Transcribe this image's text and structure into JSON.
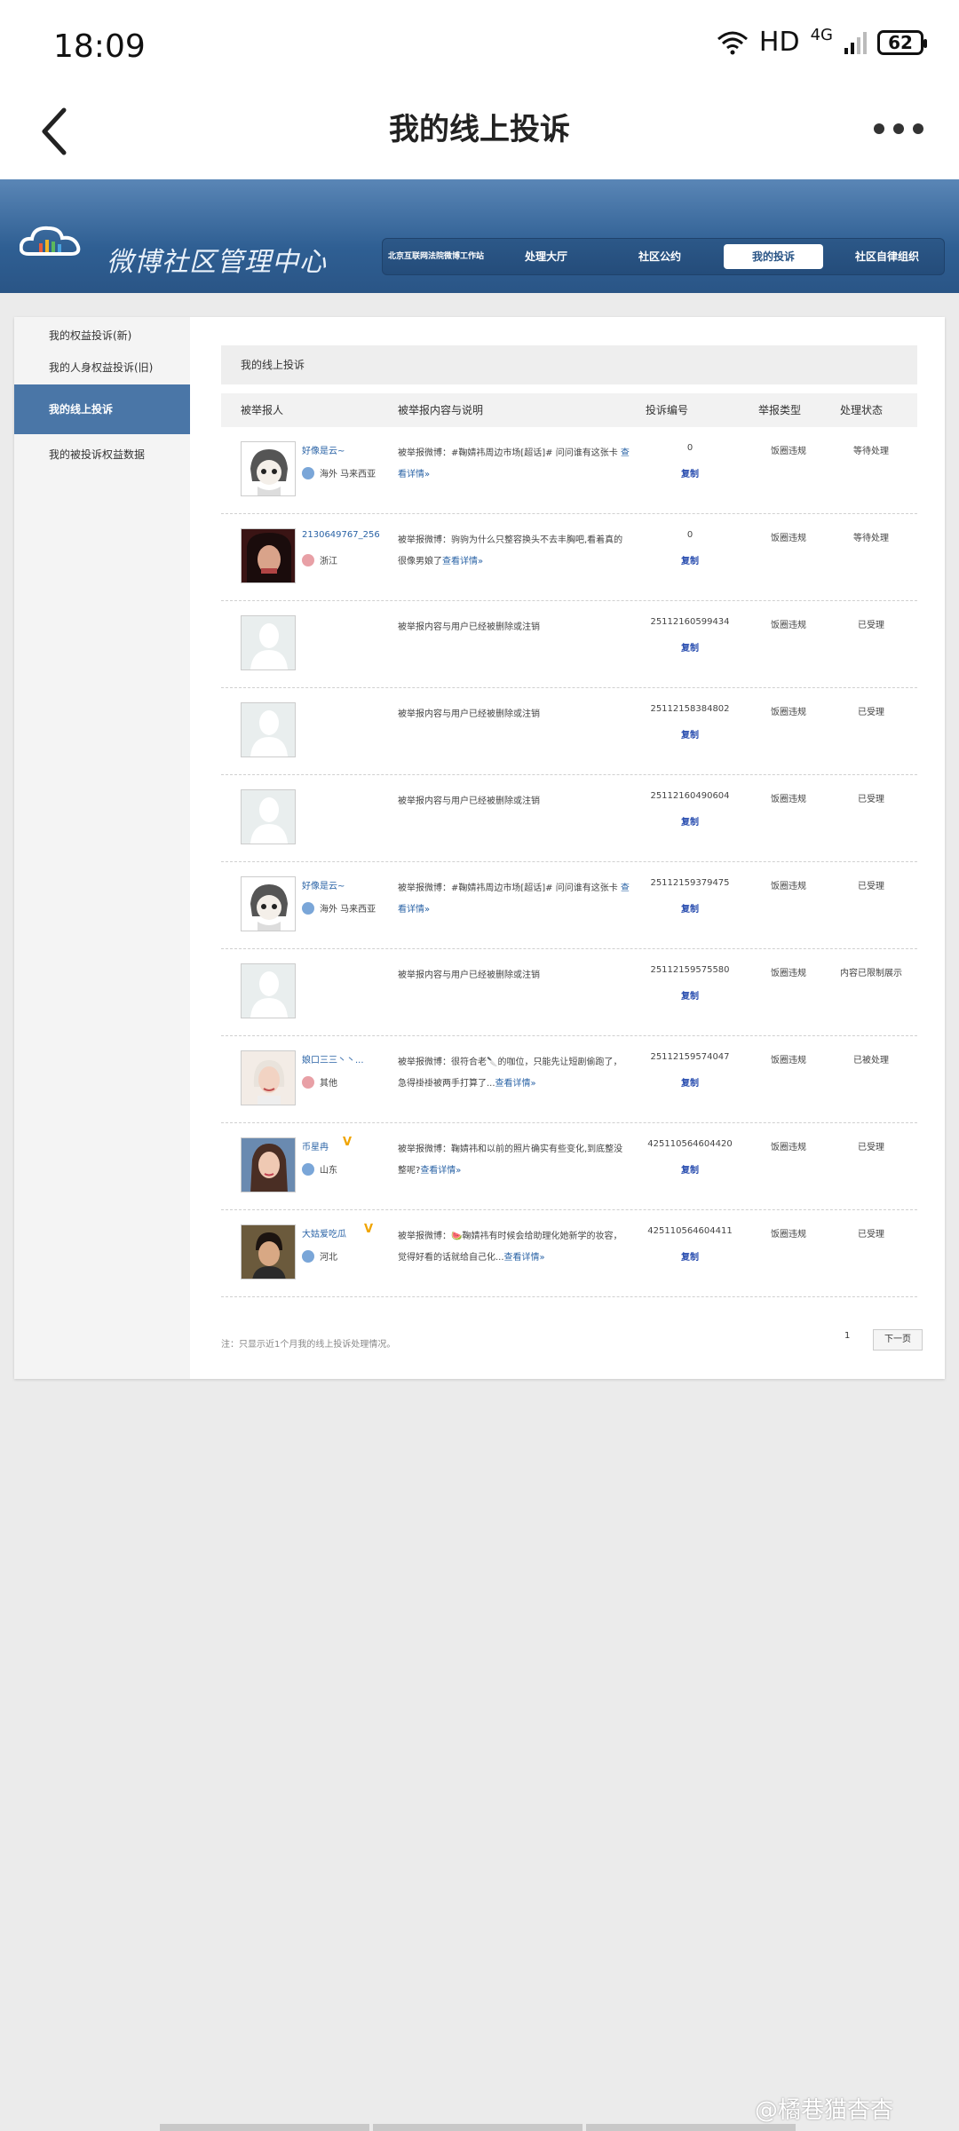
{
  "status_bar": {
    "time": "18:09",
    "network": "HD",
    "cell": "4G",
    "battery": "62"
  },
  "app_bar": {
    "title": "我的线上投诉"
  },
  "banner": {
    "brand": "微博社区管理中心",
    "nav": [
      {
        "label": "北京互联网法院微博工作站"
      },
      {
        "label": "处理大厅"
      },
      {
        "label": "社区公约"
      },
      {
        "label": "我的投诉"
      },
      {
        "label": "社区自律组织"
      }
    ]
  },
  "sidebar": {
    "items": [
      {
        "label": "我的权益投诉(新)"
      },
      {
        "label": "我的人身权益投诉(旧)"
      },
      {
        "label": "我的线上投诉"
      },
      {
        "label": "我的被投诉权益数据"
      }
    ]
  },
  "main": {
    "title": "我的线上投诉",
    "columns": {
      "reporter": "被举报人",
      "content": "被举报内容与说明",
      "id": "投诉编号",
      "type": "举报类型",
      "status": "处理状态"
    },
    "copy_label": "复制",
    "rows": [
      {
        "name": "好像是云~",
        "location": "海外 马来西亚",
        "gender": "m",
        "verified": false,
        "avatar": "anime",
        "desc": "被举报微博：#鞠婧祎周边市场[超话]# 问问谁有这张卡 ",
        "link": "查看详情»",
        "id": "0",
        "type": "饭圈违规",
        "status": "等待处理"
      },
      {
        "name": "2130649767_256",
        "location": "浙江",
        "gender": "f",
        "verified": false,
        "avatar": "dark",
        "desc": "被举报微博：驹驹为什么只整容换头不去丰胸吧,看着真的很像男娘了",
        "link": "查看详情»",
        "id": "0",
        "type": "饭圈违规",
        "status": "等待处理"
      },
      {
        "name": "",
        "location": "",
        "gender": "",
        "verified": false,
        "avatar": "blank",
        "desc": "被举报内容与用户已经被删除或注销",
        "link": "",
        "id": "25112160599434",
        "type": "饭圈违规",
        "status": "已受理"
      },
      {
        "name": "",
        "location": "",
        "gender": "",
        "verified": false,
        "avatar": "blank",
        "desc": "被举报内容与用户已经被删除或注销",
        "link": "",
        "id": "25112158384802",
        "type": "饭圈违规",
        "status": "已受理"
      },
      {
        "name": "",
        "location": "",
        "gender": "",
        "verified": false,
        "avatar": "blank",
        "desc": "被举报内容与用户已经被删除或注销",
        "link": "",
        "id": "25112160490604",
        "type": "饭圈违规",
        "status": "已受理"
      },
      {
        "name": "好像是云~",
        "location": "海外 马来西亚",
        "gender": "m",
        "verified": false,
        "avatar": "anime",
        "desc": "被举报微博：#鞠婧祎周边市场[超话]# 问问谁有这张卡 ",
        "link": "查看详情»",
        "id": "25112159379475",
        "type": "饭圈违规",
        "status": "已受理"
      },
      {
        "name": "",
        "location": "",
        "gender": "",
        "verified": false,
        "avatar": "blank",
        "desc": "被举报内容与用户已经被删除或注销",
        "link": "",
        "id": "25112159575580",
        "type": "饭圈违规",
        "status": "内容已限制展示"
      },
      {
        "name": "娘口三三丶丶...",
        "location": "其他",
        "gender": "f",
        "verified": false,
        "avatar": "girl",
        "desc": "被举报微博：很符合老🔪的咖位，只能先让短剧偷跑了，急得褂褂被两手打算了...",
        "link": "查看详情»",
        "id": "25112159574047",
        "type": "饭圈违规",
        "status": "已被处理"
      },
      {
        "name": "币星冉",
        "location": "山东",
        "gender": "m",
        "verified": true,
        "avatar": "woman",
        "desc": "被举报微博：鞠婧祎和以前的照片确实有些变化,到底整没整呢?",
        "link": "查看详情»",
        "id": "425110564604420",
        "type": "饭圈违规",
        "status": "已受理"
      },
      {
        "name": "大姑爱吃瓜",
        "location": "河北",
        "gender": "m",
        "verified": true,
        "avatar": "man",
        "desc": "被举报微博：🍉鞠婧祎有时候会给助理化她新学的妆容，觉得好看的话就给自己化...",
        "link": "查看详情»",
        "id": "425110564604411",
        "type": "饭圈违规",
        "status": "已受理"
      }
    ],
    "note": "注：只显示近1个月我的线上投诉处理情况。",
    "pager": {
      "page": "1",
      "next": "下一页"
    }
  },
  "watermark": "@橘巷猫杳杳"
}
